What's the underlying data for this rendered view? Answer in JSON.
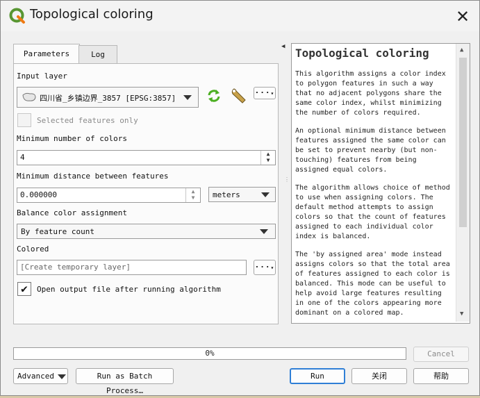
{
  "window": {
    "title": "Topological coloring",
    "logo_icon": "qgis-logo-icon",
    "close_icon": "close-icon"
  },
  "tabs": [
    {
      "label": "Parameters",
      "active": true
    },
    {
      "label": "Log",
      "active": false
    }
  ],
  "params": {
    "input_layer_label": "Input layer",
    "input_layer_value": "四川省_乡镇边界_3857 [EPSG:3857]",
    "selected_only_label": "Selected features only",
    "selected_only_checked": false,
    "min_colors_label": "Minimum number of colors",
    "min_colors_value": "4",
    "min_distance_label": "Minimum distance between features",
    "min_distance_value": "0.000000",
    "distance_unit": "meters",
    "balance_label": "Balance color assignment",
    "balance_value": "By feature count",
    "colored_label": "Colored",
    "colored_placeholder": "[Create temporary layer]",
    "open_output_label": "Open output file after running algorithm",
    "open_output_checked": true,
    "dots_label": "···"
  },
  "help": {
    "title": "Topological coloring",
    "paragraphs": [
      "This algorithm assigns a color index to polygon features in such a way that no adjacent polygons share the same color index, whilst minimizing the number of colors required.",
      "An optional minimum distance between features assigned the same color can be set to prevent nearby (but non-touching) features from being assigned equal colors.",
      "The algorithm allows choice of method to use when assigning colors. The default method attempts to assign colors so that the count of features assigned to each individual color index is balanced.",
      "The 'by assigned area' mode instead assigns colors so that the total area of features assigned to each color is balanced. This mode can be useful to help avoid large features resulting in one of the colors appearing more dominant on a colored map."
    ]
  },
  "progress": {
    "text": "0%",
    "value": 0
  },
  "buttons": {
    "cancel": "Cancel",
    "advanced": "Advanced",
    "batch": "Run as Batch Process…",
    "run": "Run",
    "close": "关闭",
    "help": "帮助"
  },
  "colors": {
    "accent": "#2f7fd6",
    "qgis_green": "#589632",
    "qgis_yellow": "#ee7913"
  }
}
